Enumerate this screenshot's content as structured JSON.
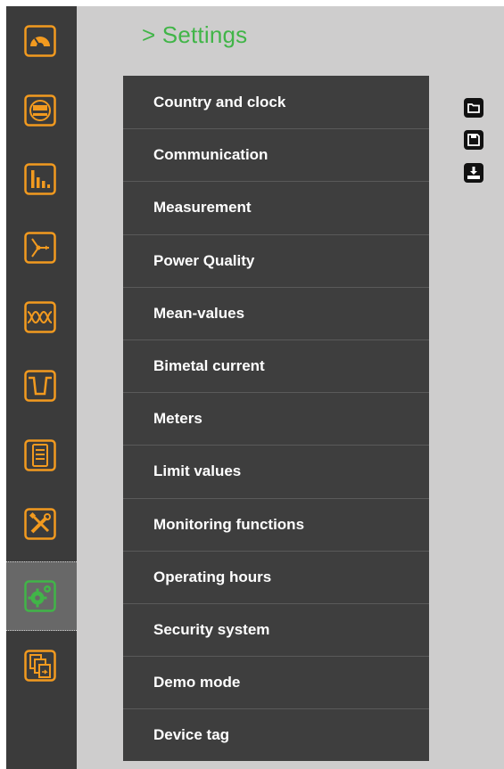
{
  "page": {
    "title": "> Settings"
  },
  "sidebar": {
    "active_index": 9,
    "items": [
      {
        "name": "gauge-icon"
      },
      {
        "name": "meter-display-icon"
      },
      {
        "name": "bar-chart-icon"
      },
      {
        "name": "vector-diagram-icon"
      },
      {
        "name": "waveform-icon"
      },
      {
        "name": "event-dip-icon"
      },
      {
        "name": "list-document-icon"
      },
      {
        "name": "tools-icon"
      },
      {
        "name": "settings-gears-icon"
      },
      {
        "name": "copy-documents-icon"
      }
    ]
  },
  "settings_menu": {
    "items": [
      {
        "label": "Country and clock"
      },
      {
        "label": "Communication"
      },
      {
        "label": "Measurement"
      },
      {
        "label": "Power Quality"
      },
      {
        "label": "Mean-values"
      },
      {
        "label": "Bimetal current"
      },
      {
        "label": "Meters"
      },
      {
        "label": "Limit values"
      },
      {
        "label": "Monitoring functions"
      },
      {
        "label": "Operating hours"
      },
      {
        "label": "Security system"
      },
      {
        "label": "Demo mode"
      },
      {
        "label": "Device tag"
      }
    ]
  },
  "toolbar": {
    "items": [
      {
        "name": "open-folder-icon"
      },
      {
        "name": "save-disk-icon"
      },
      {
        "name": "download-icon"
      }
    ]
  },
  "colors": {
    "accent_orange": "#f29a1f",
    "accent_green": "#41b548",
    "sidebar_bg": "#3b3b3b",
    "main_bg": "#cecdcd",
    "menu_bg": "#3e3e3e"
  }
}
